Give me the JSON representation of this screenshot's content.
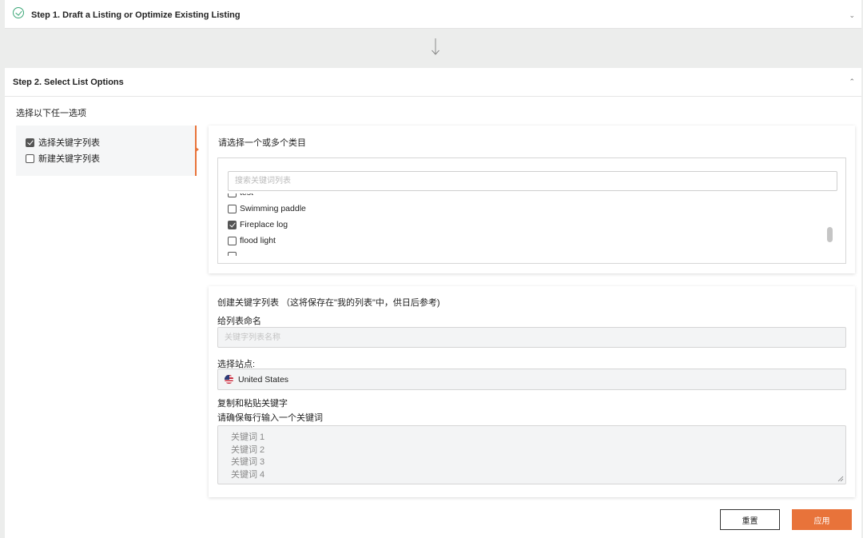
{
  "step1": {
    "title": "Step 1. Draft a Listing or Optimize Existing Listing",
    "chevron": "⌄"
  },
  "step2": {
    "title": "Step 2. Select List Options",
    "chevron": "⌃"
  },
  "choose_label": "选择以下任一选项",
  "options": [
    {
      "label": "选择关键字列表",
      "checked": true
    },
    {
      "label": "新建关键字列表",
      "checked": false
    }
  ],
  "category": {
    "label": "请选择一个或多个类目",
    "search_placeholder": "搜索关键词列表",
    "items": [
      {
        "label": "test",
        "checked": false
      },
      {
        "label": "Swimming paddle",
        "checked": false
      },
      {
        "label": "Fireplace log",
        "checked": true
      },
      {
        "label": "flood light",
        "checked": false
      }
    ]
  },
  "create": {
    "title": "创建关键字列表 （这将保存在\"我的列表\"中，供日后参考)",
    "name_label": "给列表命名",
    "name_placeholder": "关键字列表名称",
    "site_label": "选择站点:",
    "site_value": "United States",
    "paste_label": "复制和粘贴关键字",
    "paste_hint": "请确保每行输入一个关键词",
    "keywords": [
      "关键词 1",
      "关键词 2",
      "关键词 3",
      "关键词 4"
    ]
  },
  "buttons": {
    "reset": "重置",
    "apply": "应用"
  },
  "colors": {
    "accent": "#e8733a",
    "check_green": "#3aa676"
  }
}
